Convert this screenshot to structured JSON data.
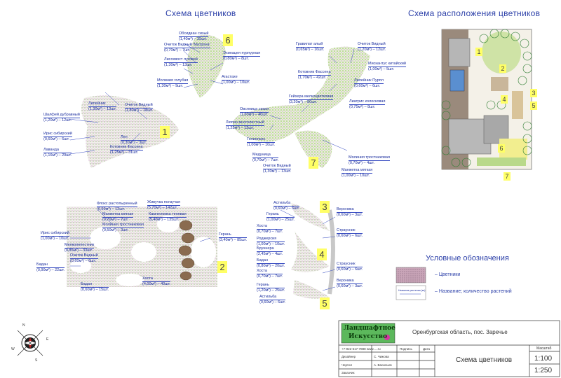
{
  "titles": {
    "left": "Схема цветников",
    "right": "Схема расположения цветников"
  },
  "beds": {
    "b1": {
      "num": "1",
      "labels": [
        {
          "t": "Лилейник",
          "v": "(1,30м²) – 13шт."
        },
        {
          "t": "Очиток Видный",
          "v": "(1,80м²) – 18шт."
        },
        {
          "t": "Шалфей дубравный",
          "v": "(1,20м²) – 12шт."
        },
        {
          "t": "Ирис сибирский",
          "v": "(0,60м²) – 6шт."
        },
        {
          "t": "Лен",
          "v": "(0,30м²) – 3шт."
        },
        {
          "t": "Котовник Фассена",
          "v": "(1,25м²) – 31шт."
        },
        {
          "t": "Лаванда",
          "v": "(1,16м²) – 29шт."
        }
      ]
    },
    "b6": {
      "num": "6",
      "labels": [
        {
          "t": "Обсидиан сизый",
          "v": "(1,40м²) – 35шт."
        },
        {
          "t": "Очиток Видный 'Матрона'",
          "v": "(0,70м²) – 7шт."
        },
        {
          "t": "Эхинацея пурпурная",
          "v": "(0,80м²) – 8шт."
        },
        {
          "t": "Лисохвост луговой",
          "v": "(1,30м²) – 13шт."
        },
        {
          "t": "Молиния голубая",
          "v": "(1,30м²) – 9шт."
        },
        {
          "t": "Агастахе",
          "v": "(1,00м²) – 10шт."
        }
      ]
    },
    "b7": {
      "num": "7",
      "labels": [
        {
          "t": "Гравилат алый",
          "v": "(0,65м²) – 16шт."
        },
        {
          "t": "Очиток Видный",
          "v": "(1,20м²) – 12шт."
        },
        {
          "t": "Мискантус китайский",
          "v": "(1,00м²) – 5шт."
        },
        {
          "t": "Котовник Фассена",
          "v": "(1,70м²) – 42шт."
        },
        {
          "t": "Лилейник Пурпл",
          "v": "(0,60м²) – 6шт."
        },
        {
          "t": "Гейхера мелкоцветковая",
          "v": "(3,20м²) – 80шт."
        },
        {
          "t": "Лиатрис колосковая",
          "v": "(0,75м²) – 8шт."
        },
        {
          "t": "Овсяница сизая",
          "v": "(1,60м²) – 40шт."
        },
        {
          "t": "Люпин многолистный",
          "v": "(1,25м²) – 13шт."
        },
        {
          "t": "Гелиопсис",
          "v": "(1,00м²) – 10шт."
        },
        {
          "t": "Медуница",
          "v": "(0,70м²) – 7шт."
        },
        {
          "t": "Очиток Видный",
          "v": "(1,30м²) – 13шт."
        },
        {
          "t": "Молиния тростниковая",
          "v": "(0,70м²) – 4шт."
        },
        {
          "t": "Манжетка мягкая",
          "v": "(1,00м²) – 10шт."
        }
      ]
    },
    "b2": {
      "num": "2",
      "labels": [
        {
          "t": "Флокс растопыренный",
          "v": "(0,50м²) – 12шт."
        },
        {
          "t": "Живучка ползучая",
          "v": "(5,70м²) – 142шт."
        },
        {
          "t": "Манжетка мягкая",
          "v": "(0,70м²) – 7шт."
        },
        {
          "t": "Камнеломка теневая",
          "v": "(5,40м²) – 135шт."
        },
        {
          "t": "Молиния тростниковая",
          "v": "(0,50м²) – 3шт."
        },
        {
          "t": "Ирис сибирский",
          "v": "(1,00м²) – 10шт."
        },
        {
          "t": "Герань",
          "v": "(3,40м²) – 85шт."
        },
        {
          "t": "Мелколепестник",
          "v": "(0,85м²) – 33шт."
        },
        {
          "t": "Очиток Видный",
          "v": "(0,60м²) – 6шт."
        },
        {
          "t": "Бадан",
          "v": "(0,90м²) – 22шт."
        },
        {
          "t": "Хоста",
          "v": "(4,00м²) – 40шт."
        },
        {
          "t": "Бадан",
          "v": "(0,60м²) – 15шт."
        }
      ]
    },
    "b345": {
      "labels": [
        {
          "t": "Астильба",
          "v": "(0,60м²) – 6шт."
        },
        {
          "t": "Герань",
          "v": "(1,00м²) – 25шт."
        },
        {
          "t": "Хоста",
          "v": "(0,70м²) – 7шт."
        },
        {
          "t": "Роджерсия",
          "v": "(1,00м²) – 10шт."
        },
        {
          "t": "Бруннера",
          "v": "(2,45м²) – 4шт."
        },
        {
          "t": "Бадан",
          "v": "(0,80м²) – 20шт."
        },
        {
          "t": "Хоста",
          "v": "(0,70м²) – 7шт."
        },
        {
          "t": "Вероника",
          "v": "(0,60м²) – 3шт."
        },
        {
          "t": "Страусник",
          "v": "(0,60м²) – 6шт."
        },
        {
          "t": "Страусник",
          "v": "(0,60м²) – 6шт."
        },
        {
          "t": "Вероника",
          "v": "(0,60м²) – 3шт."
        },
        {
          "t": "Герань",
          "v": "(1,20м²) – 25шт."
        },
        {
          "t": "Астильба",
          "v": "(0,60м²) – 6шт."
        }
      ],
      "nums": [
        "3",
        "4",
        "5"
      ]
    }
  },
  "plan_numbers": [
    "1",
    "2",
    "3",
    "4",
    "5",
    "6",
    "7"
  ],
  "legend": {
    "title": "Условные обозначения",
    "item1": "– Цветники",
    "item2": "– Название; количество растений",
    "sample": "Название растения (м²)"
  },
  "stamp": {
    "logo_line1": "Ландшафтное",
    "logo_line2": "Искусство",
    "location": "Оренбургская область, пос. Заречье",
    "contacts": "+7-922-517-7888 www.....ru",
    "rows": [
      {
        "role": "Дизайнер",
        "name": "С. Чижова"
      },
      {
        "role": "Чертил",
        "name": "А. Васильев"
      },
      {
        "role": "Заказчик",
        "name": ""
      }
    ],
    "cols": {
      "sign": "Подпись",
      "date": "Дата"
    },
    "sheet_title": "Схема цветников",
    "scale_label": "Масштаб",
    "scale1": "1:100",
    "scale2": "1:250"
  },
  "compass": {
    "n": "N",
    "s": "S",
    "e": "E",
    "w": "W"
  },
  "colors": {
    "blue": "#1f3fbf",
    "highlight": "#ffff66",
    "bed": "#b8d69a"
  }
}
